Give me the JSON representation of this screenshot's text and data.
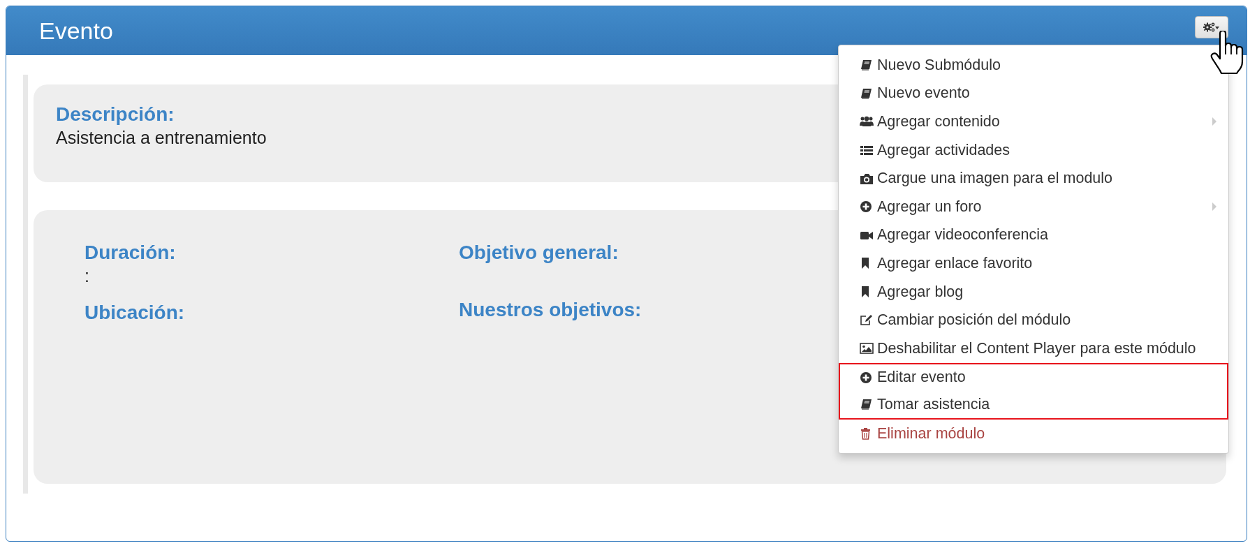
{
  "panel": {
    "title": "Evento"
  },
  "description": {
    "label": "Descripción:",
    "value": "Asistencia a entrenamiento"
  },
  "details": {
    "columns": [
      [
        {
          "label": "Duración:",
          "value": ":"
        },
        {
          "label": "Ubicación:"
        }
      ],
      [
        {
          "label": "Objetivo general:"
        },
        {
          "label": "Nuestros objetivos:"
        }
      ]
    ]
  },
  "menu": {
    "items": [
      {
        "label": "Nuevo Submódulo",
        "kind": "action",
        "highlighted": false
      },
      {
        "label": "Nuevo evento",
        "kind": "action",
        "highlighted": false
      },
      {
        "label": "Agregar contenido",
        "kind": "submenu",
        "highlighted": false
      },
      {
        "label": "Agregar actividades",
        "kind": "action",
        "highlighted": false
      },
      {
        "label": "Cargue una imagen para el modulo",
        "kind": "action",
        "highlighted": false
      },
      {
        "label": "Agregar un foro",
        "kind": "submenu",
        "highlighted": false
      },
      {
        "label": "Agregar videoconferencia",
        "kind": "action",
        "highlighted": false
      },
      {
        "label": "Agregar enlace favorito",
        "kind": "action",
        "highlighted": false
      },
      {
        "label": "Agregar blog",
        "kind": "action",
        "highlighted": false
      },
      {
        "label": "Cambiar posición del módulo",
        "kind": "action",
        "highlighted": false
      },
      {
        "label": "Deshabilitar el Content Player para este módulo",
        "kind": "action",
        "highlighted": false
      },
      {
        "label": "Editar evento",
        "kind": "action",
        "highlighted": true
      },
      {
        "label": "Tomar asistencia",
        "kind": "action",
        "highlighted": true
      },
      {
        "label": "Eliminar módulo",
        "kind": "danger",
        "highlighted": false
      }
    ]
  }
}
